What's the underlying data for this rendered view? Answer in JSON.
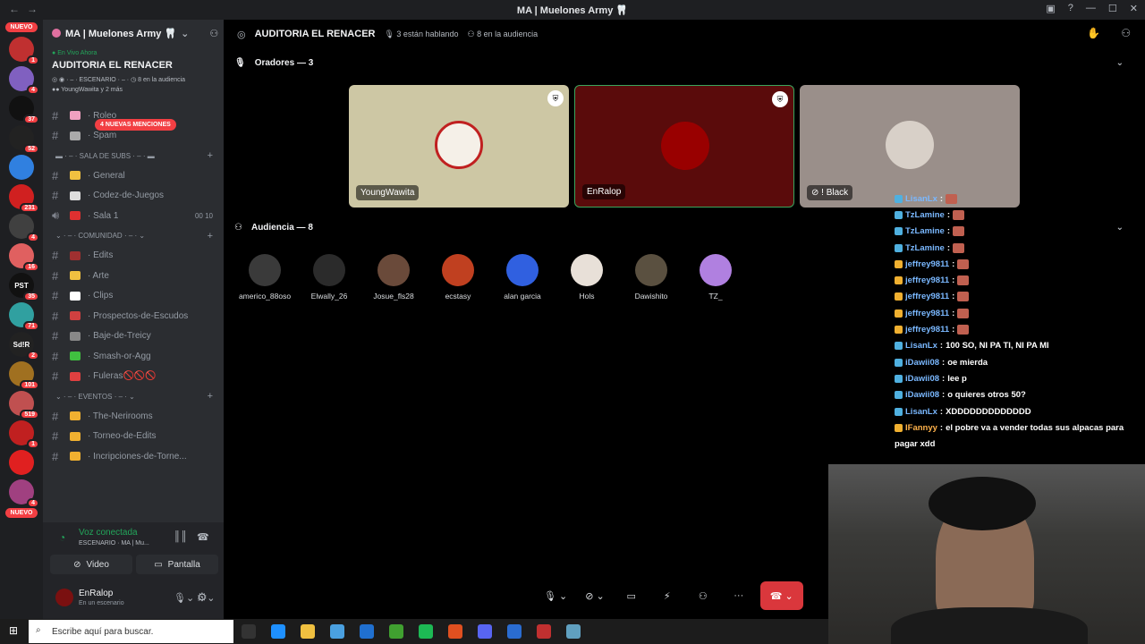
{
  "window": {
    "title": "MA | Muelones Army 🦷"
  },
  "servers": {
    "new_label": "NUEVO",
    "items": [
      {
        "badge": "1"
      },
      {
        "badge": "4"
      },
      {
        "badge": "37"
      },
      {
        "badge": "52"
      },
      {
        "badge": ""
      },
      {
        "badge": "231"
      },
      {
        "badge": "4"
      },
      {
        "badge": "16"
      },
      {
        "badge": "35",
        "text": "PST"
      },
      {
        "badge": "71"
      },
      {
        "badge": "2",
        "text": "Sd!R"
      },
      {
        "badge": "101"
      },
      {
        "badge": "519"
      },
      {
        "badge": "1"
      },
      {
        "badge": ""
      },
      {
        "badge": "4"
      }
    ],
    "new_label_bottom": "NUEVO"
  },
  "sidebar": {
    "server_name": "MA | Muelones Army 🦷",
    "stage": {
      "live_label": "En Vivo Ahora",
      "title": "AUDITORIA EL RENACER",
      "meta": "ESCENARIO",
      "audience": "8 en la audiencia",
      "speakers": "YoungWawita y 2 más"
    },
    "mentions": "4 NUEVAS MENCIONES",
    "channels_top": [
      {
        "name": "Roleo",
        "color": "#f0a0c0"
      },
      {
        "name": "Spam",
        "color": "#aaaaaa"
      }
    ],
    "cat_subs": "SALA DE SUBS",
    "channels_subs": [
      {
        "name": "General",
        "color": "#f0c040"
      },
      {
        "name": "Codez-de-Juegos",
        "color": "#dddddd"
      },
      {
        "name": "Sala 1",
        "color": "#e03030",
        "voice": true,
        "c1": "00",
        "c2": "10"
      }
    ],
    "cat_comunidad": "COMUNIDAD",
    "channels_com": [
      {
        "name": "Edits",
        "color": "#a03030"
      },
      {
        "name": "Arte",
        "color": "#f0c040"
      },
      {
        "name": "Clips",
        "color": "#ffffff"
      },
      {
        "name": "Prospectos-de-Escudos",
        "color": "#d04040"
      },
      {
        "name": "Baje-de-Treicy",
        "color": "#888888"
      },
      {
        "name": "Smash-or-Agg",
        "color": "#40c040"
      },
      {
        "name": "Fuleras🚫🚫🚫",
        "color": "#e04040"
      }
    ],
    "cat_eventos": "EVENTOS",
    "channels_ev": [
      {
        "name": "The-Nerirooms",
        "color": "#f0b030"
      },
      {
        "name": "Torneo-de-Edits",
        "color": "#f0b030"
      },
      {
        "name": "Incripciones-de-Torne...",
        "color": "#f0b030"
      }
    ],
    "voice": {
      "status": "Voz conectada",
      "sub": "ESCENARIO · MA | Mu...",
      "video": "Video",
      "screen": "Pantalla"
    },
    "user": {
      "name": "EnRalop",
      "status": "En un escenario"
    }
  },
  "stage_top": {
    "title": "AUDITORIA EL RENACER",
    "talking": "3 están hablando",
    "audience": "8 en la audiencia"
  },
  "speakers_section": {
    "label": "Oradores — 3"
  },
  "speakers": [
    {
      "name": "YoungWawita",
      "bg": "#cdc7a4"
    },
    {
      "name": "EnRalop",
      "bg": "#5a0b0b"
    },
    {
      "name": "! Black",
      "bg": "#9a8f8a"
    }
  ],
  "audience_section": {
    "label": "Audiencia — 8"
  },
  "audience": [
    {
      "name": "americo_88oso",
      "color": "#3a3a3a"
    },
    {
      "name": "Elwally_26",
      "color": "#2b2b2b"
    },
    {
      "name": "Josue_fls28",
      "color": "#6a4a3a"
    },
    {
      "name": "ecstasy",
      "color": "#c04020"
    },
    {
      "name": "alan garcia",
      "color": "#3060e0"
    },
    {
      "name": "Hols",
      "color": "#e8e0d8"
    },
    {
      "name": "Dawishito",
      "color": "#5a5040"
    },
    {
      "name": "ꓔZ_",
      "color": "#b080e0"
    }
  ],
  "chat": [
    {
      "user": "LisanLx",
      "msg": "",
      "badge": "#4fb0e0",
      "cls": ""
    },
    {
      "user": "TzLamine",
      "msg": "",
      "badge": "#4fb0e0",
      "cls": ""
    },
    {
      "user": "TzLamine",
      "msg": "",
      "badge": "#4fb0e0",
      "cls": ""
    },
    {
      "user": "TzLamine",
      "msg": "",
      "badge": "#4fb0e0",
      "cls": ""
    },
    {
      "user": "jeffrey9811",
      "msg": "",
      "badge": "#f0b030",
      "cls": ""
    },
    {
      "user": "jeffrey9811",
      "msg": "",
      "badge": "#f0b030",
      "cls": ""
    },
    {
      "user": "jeffrey9811",
      "msg": "",
      "badge": "#f0b030",
      "cls": ""
    },
    {
      "user": "jeffrey9811",
      "msg": "",
      "badge": "#f0b030",
      "cls": ""
    },
    {
      "user": "jeffrey9811",
      "msg": "",
      "badge": "#f0b030",
      "cls": ""
    },
    {
      "user": "LisanLx",
      "msg": "100 SO, NI PA TI, NI PA MI",
      "badge": "#4fb0e0",
      "cls": ""
    },
    {
      "user": "iDawii08",
      "msg": "oe mierda",
      "badge": "#4fb0e0",
      "cls": ""
    },
    {
      "user": "iDawii08",
      "msg": "lee p",
      "badge": "#4fb0e0",
      "cls": ""
    },
    {
      "user": "iDawii08",
      "msg": "o quieres otros 50?",
      "badge": "#4fb0e0",
      "cls": ""
    },
    {
      "user": "LisanLx",
      "msg": "XDDDDDDDDDDDDD",
      "badge": "#4fb0e0",
      "cls": ""
    },
    {
      "user": "IFannyy",
      "msg": "el pobre va a vender todas sus alpacas para",
      "badge": "#f0b030",
      "cls": "y"
    },
    {
      "user": "",
      "msg": "pagar xdd",
      "badge": "",
      "cls": ""
    }
  ],
  "taskbar": {
    "search_placeholder": "Escribe aquí para buscar."
  }
}
